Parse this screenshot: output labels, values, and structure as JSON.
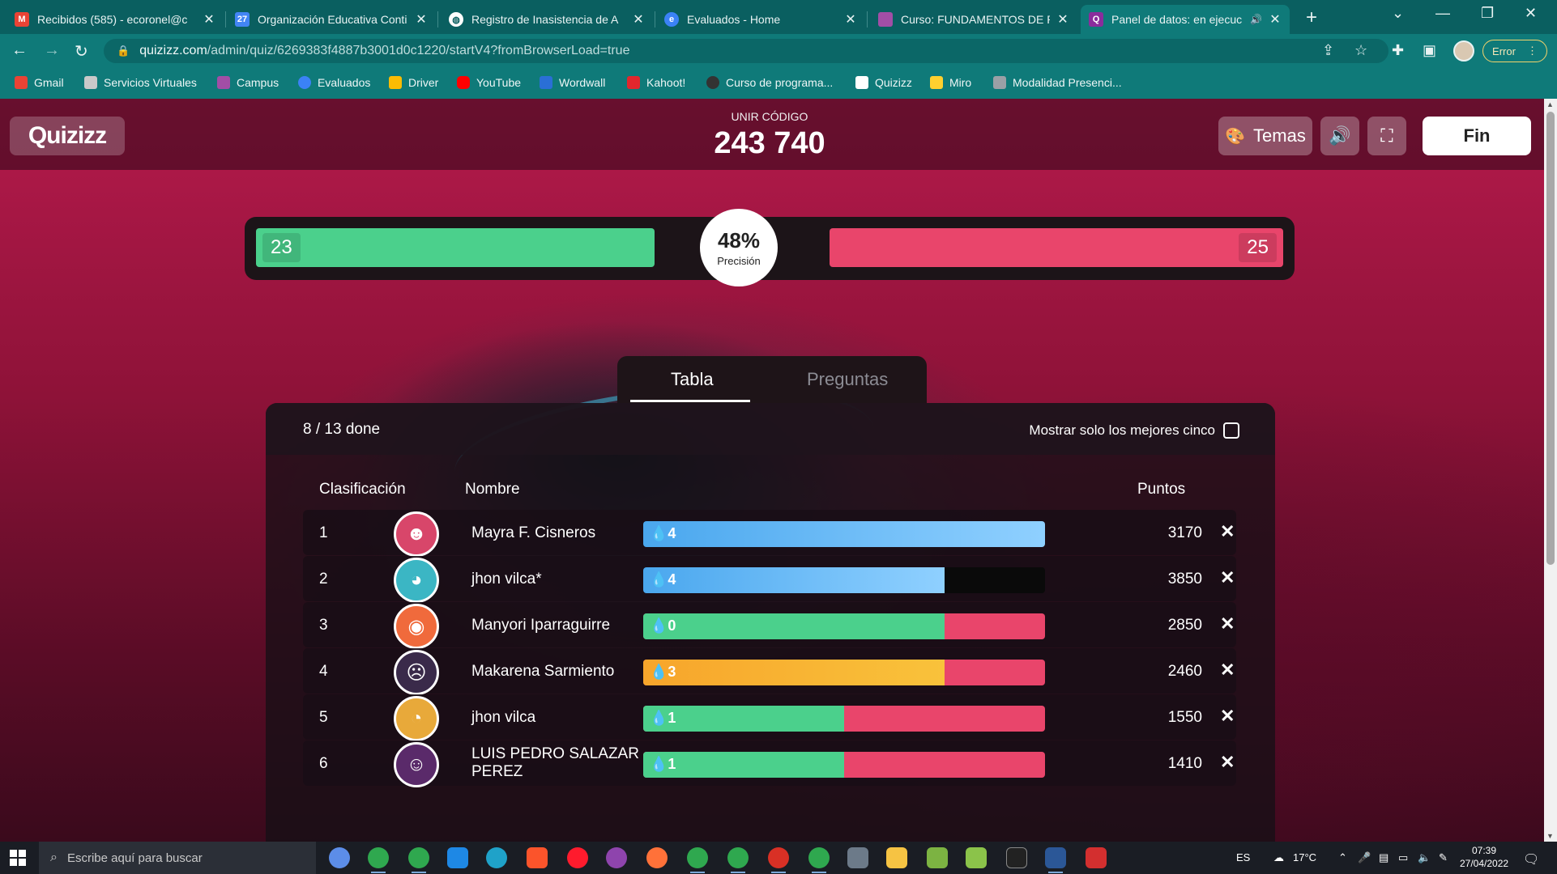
{
  "browser": {
    "tabs": [
      {
        "title": "Recibidos (585) - ecoronel@c",
        "favicon": "gmail-icon",
        "color": "#ea4335"
      },
      {
        "title": "Organización Educativa Conti",
        "favicon": "calendar-icon",
        "color": "#4285f4"
      },
      {
        "title": "Registro de Inasistencia de A",
        "favicon": "globe-icon",
        "color": "#ffffff"
      },
      {
        "title": "Evaluados - Home",
        "favicon": "evaluados-icon",
        "color": "#3b82f6"
      },
      {
        "title": "Curso: FUNDAMENTOS DE PR",
        "favicon": "campus-icon",
        "color": "#a24ea6"
      },
      {
        "title": "Panel de datos: en ejecuc",
        "favicon": "quizizz-icon",
        "color": "#8b2c9c"
      }
    ],
    "url": {
      "host": "quizizz.com",
      "path": "/admin/quiz/6269383f4887b3001d0c1220/startV4?fromBrowserLoad=true"
    },
    "error_label": "Error",
    "bookmarks": [
      {
        "label": "Gmail",
        "color": "#ea4335"
      },
      {
        "label": "Servicios Virtuales",
        "color": "#c9c9c9"
      },
      {
        "label": "Campus",
        "color": "#a24ea6"
      },
      {
        "label": "Evaluados",
        "color": "#3b82f6"
      },
      {
        "label": "Driver",
        "color": "#fbbc04"
      },
      {
        "label": "YouTube",
        "color": "#ff0000"
      },
      {
        "label": "Wordwall",
        "color": "#2a6fd6"
      },
      {
        "label": "Kahoot!",
        "color": "#e2262d"
      },
      {
        "label": "Curso de programa...",
        "color": "#333333"
      },
      {
        "label": "Quizizz",
        "color": "#ffffff"
      },
      {
        "label": "Miro",
        "color": "#ffd02f"
      },
      {
        "label": "Modalidad Presenci...",
        "color": "#9aa0a6"
      }
    ]
  },
  "app": {
    "logo": "Quizizz",
    "join_label": "UNIR CÓDIGO",
    "join_code": "243 740",
    "themes_label": "Temas",
    "end_label": "Fin",
    "accuracy": {
      "correct": "23",
      "incorrect": "25",
      "percent": "48%",
      "label": "Precisión"
    },
    "tabs": {
      "active": "Tabla",
      "inactive": "Preguntas"
    },
    "progress": "8 / 13 done",
    "top5_label": "Mostrar solo los mejores cinco",
    "columns": {
      "rank": "Clasificación",
      "name": "Nombre",
      "points": "Puntos"
    },
    "players": [
      {
        "rank": "1",
        "name": "Mayra F. Cisneros",
        "streak": "4",
        "points": "3170",
        "correct_fraction": 1.0,
        "fill": "blue",
        "rest": "none"
      },
      {
        "rank": "2",
        "name": "jhon vilca*",
        "streak": "4",
        "points": "3850",
        "correct_fraction": 0.75,
        "fill": "blue",
        "rest": "black"
      },
      {
        "rank": "3",
        "name": "Manyori Iparraguirre",
        "streak": "0",
        "points": "2850",
        "correct_fraction": 0.75,
        "fill": "green",
        "rest": "red"
      },
      {
        "rank": "4",
        "name": "Makarena Sarmiento",
        "streak": "3",
        "points": "2460",
        "correct_fraction": 0.75,
        "fill": "orange",
        "rest": "red"
      },
      {
        "rank": "5",
        "name": "jhon vilca",
        "streak": "1",
        "points": "1550",
        "correct_fraction": 0.5,
        "fill": "green",
        "rest": "red"
      },
      {
        "rank": "6",
        "name": "LUIS PEDRO SALAZAR PEREZ",
        "streak": "1",
        "points": "1410",
        "correct_fraction": 0.5,
        "fill": "green",
        "rest": "red"
      }
    ]
  },
  "taskbar": {
    "search_placeholder": "Escribe aquí para buscar",
    "lang": "ES",
    "weather": "17°C",
    "time": "07:39",
    "date": "27/04/2022"
  }
}
